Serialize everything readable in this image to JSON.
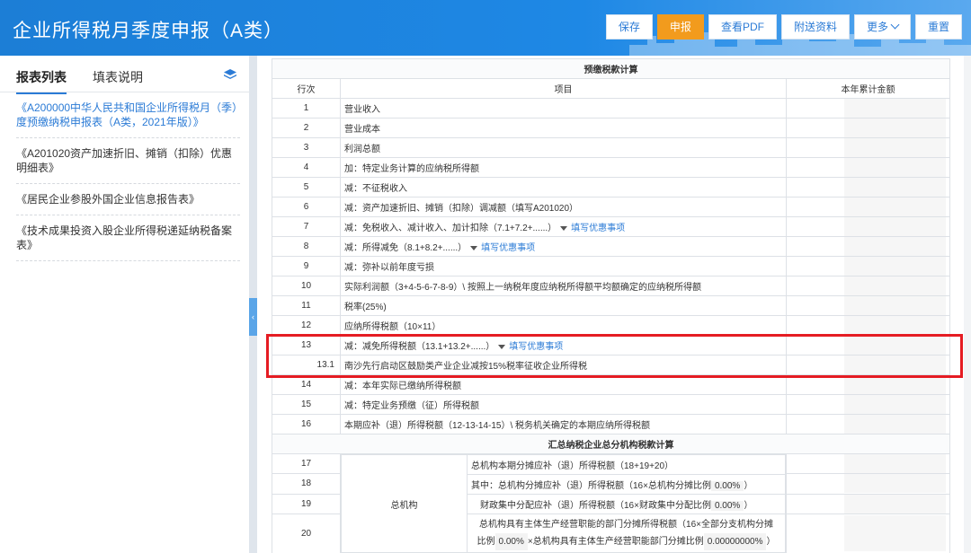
{
  "header": {
    "title": "企业所得税月季度申报（A类）",
    "buttons": {
      "save": "保存",
      "declare": "申报",
      "pdf": "查看PDF",
      "attach": "附送资料",
      "more": "更多",
      "reset": "重置"
    }
  },
  "sidebar": {
    "tab_list": "报表列表",
    "tab_help": "填表说明",
    "items": [
      "《A200000中华人民共和国企业所得税月（季）度预缴纳税申报表（A类，2021年版）》",
      "《A201020资产加速折旧、摊销（扣除）优惠明细表》",
      "《居民企业参股外国企业信息报告表》",
      "《技术成果投资入股企业所得税递延纳税备案表》"
    ]
  },
  "table": {
    "section1": "预缴税款计算",
    "col_row": "行次",
    "col_item": "项目",
    "col_amount": "本年累计金额",
    "rows": [
      {
        "no": "1",
        "item": "营业收入"
      },
      {
        "no": "2",
        "item": "营业成本"
      },
      {
        "no": "3",
        "item": "利润总额"
      },
      {
        "no": "4",
        "item": "加：特定业务计算的应纳税所得额"
      },
      {
        "no": "5",
        "item": "减：不征税收入"
      },
      {
        "no": "6",
        "item": "减：资产加速折旧、摊销（扣除）调减额（填写A201020）"
      },
      {
        "no": "7",
        "item": "减：免税收入、减计收入、加计扣除（7.1+7.2+......）",
        "link": "填写优惠事项"
      },
      {
        "no": "8",
        "item": "减：所得减免（8.1+8.2+......）",
        "link": "填写优惠事项"
      },
      {
        "no": "9",
        "item": "减：弥补以前年度亏损"
      },
      {
        "no": "10",
        "item": "实际利润额（3+4-5-6-7-8-9）\\ 按照上一纳税年度应纳税所得额平均额确定的应纳税所得额"
      },
      {
        "no": "11",
        "item": "税率(25%)"
      },
      {
        "no": "12",
        "item": "应纳所得税额（10×11）"
      },
      {
        "no": "13",
        "item": "减：减免所得税额（13.1+13.2+......）",
        "link": "填写优惠事项"
      },
      {
        "no": "13.1",
        "item": "南沙先行启动区鼓励类产业企业减按15%税率征收企业所得税"
      },
      {
        "no": "14",
        "item": "减：本年实际已缴纳所得税额"
      },
      {
        "no": "15",
        "item": "减：特定业务预缴（征）所得税额"
      },
      {
        "no": "16",
        "item": "本期应补（退）所得税额（12-13-14-15）\\ 税务机关确定的本期应纳所得税额"
      }
    ],
    "section2": "汇总纳税企业总分机构税款计算",
    "hq_label": "总机构",
    "hq_rows": [
      {
        "no": "17",
        "item": "总机构本期分摊应补（退）所得税额（18+19+20）"
      },
      {
        "no": "18",
        "item": "其中：总机构分摊应补（退）所得税额（16×总机构分摊比例",
        "pct": "0.00%",
        "tail": "）"
      },
      {
        "no": "19",
        "item": "财政集中分配应补（退）所得税额（16×财政集中分配比例",
        "pct": "0.00%",
        "tail": "）"
      },
      {
        "no": "20",
        "item": "总机构具有主体生产经营职能的部门分摊所得税额（16×全部分支机构分摊",
        "item2": "比例",
        "pct": "0.00%",
        "mid": "×总机构具有主体生产经营职能部门分摊比例",
        "pct2": "0.00000000%",
        "tail": "）"
      }
    ]
  },
  "colors": {
    "header_blue": "#1e88e5",
    "declare_orange": "#f29b1d",
    "link_blue": "#2b7bd6",
    "highlight_red": "#e51c23"
  }
}
